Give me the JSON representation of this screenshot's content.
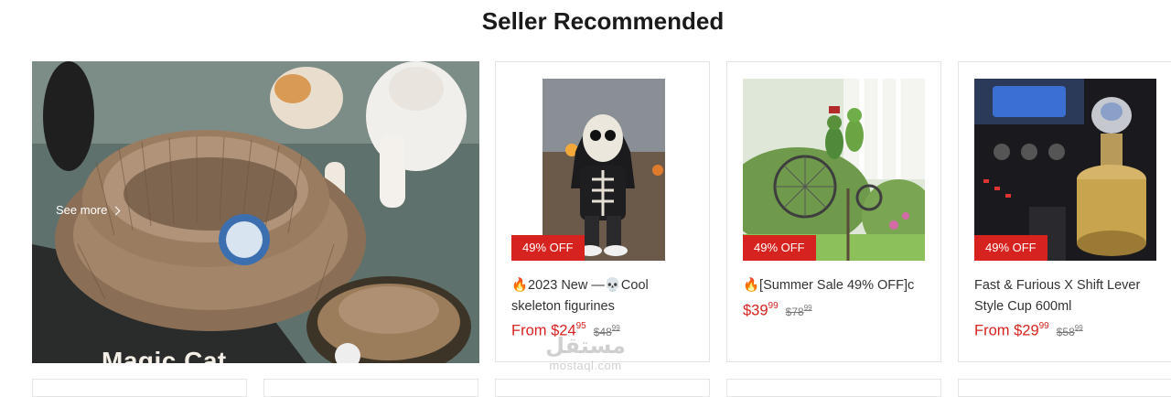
{
  "section": {
    "title": "Seller Recommended"
  },
  "hero": {
    "see_more": "See more",
    "banner_text": "Magic Cat"
  },
  "products": [
    {
      "title": "🔥2023 New —💀Cool skeleton figurines",
      "badge": "49% OFF",
      "price_prefix": "From ",
      "price_main": "$24",
      "price_cents": "95",
      "orig_main": "$48",
      "orig_cents": "99"
    },
    {
      "title": "🔥[Summer Sale 49% OFF]c",
      "badge": "49% OFF",
      "price_prefix": "",
      "price_main": "$39",
      "price_cents": "99",
      "orig_main": "$78",
      "orig_cents": "99"
    },
    {
      "title": "Fast & Furious X Shift Lever Style Cup 600ml",
      "badge": "49% OFF",
      "price_prefix": "From ",
      "price_main": "$29",
      "price_cents": "99",
      "orig_main": "$58",
      "orig_cents": "99"
    }
  ],
  "watermark": {
    "arabic": "مستقل",
    "latin": "mostaql.com"
  },
  "colors": {
    "sale_red": "#d7231f",
    "border": "#e4e4e4"
  },
  "icons": {
    "see_more_arrow": "chevron-right-icon"
  }
}
